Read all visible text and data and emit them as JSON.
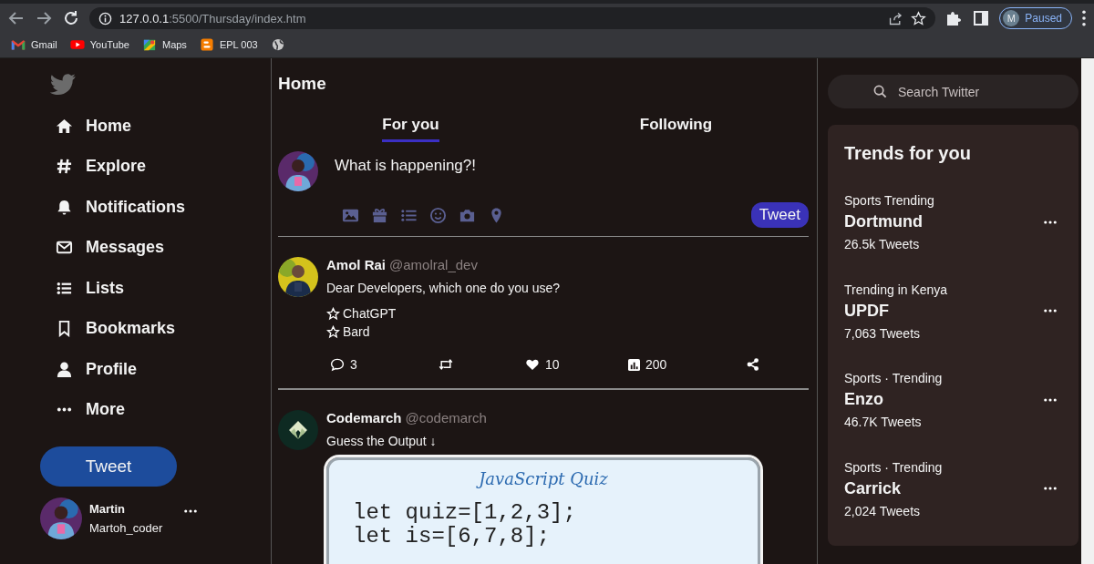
{
  "browser": {
    "address": {
      "host": "127.0.0.1",
      "path": ":5500/Thursday/index.htm"
    },
    "profile": {
      "initial": "M",
      "status": "Paused"
    },
    "bookmarks": [
      "Gmail",
      "YouTube",
      "Maps",
      "EPL 003"
    ]
  },
  "sidebar": {
    "items": [
      "Home",
      "Explore",
      "Notifications",
      "Messages",
      "Lists",
      "Bookmarks",
      "Profile",
      "More"
    ],
    "tweet_button": "Tweet",
    "account": {
      "name": "Martin",
      "handle": "Martoh_coder"
    }
  },
  "feed": {
    "title": "Home",
    "tabs": [
      {
        "label": "For you",
        "selected": true
      },
      {
        "label": "Following",
        "selected": false
      }
    ],
    "composer": {
      "placeholder": "What is happening?!",
      "button": "Tweet"
    },
    "tweets": [
      {
        "name": "Amol Rai",
        "handle": "@amolral_dev",
        "text": "Dear Developers, which one do you use?",
        "options": [
          "ChatGPT",
          "Bard"
        ],
        "replies": "3",
        "likes": "10",
        "views": "200"
      },
      {
        "name": "Codemarch",
        "handle": "@codemarch",
        "text": "Guess the Output ↓",
        "card": {
          "title": "JavaScript Quiz",
          "code": [
            "let quiz=[1,2,3];",
            "let is=[6,7,8];"
          ]
        }
      }
    ]
  },
  "search": {
    "placeholder": "Search Twitter"
  },
  "trends": {
    "title": "Trends for you",
    "items": [
      {
        "category": "Sports Trending",
        "name": "Dortmund",
        "count": "26.5k Tweets"
      },
      {
        "category": "Trending in Kenya",
        "name": "UPDF",
        "count": "7,063 Tweets"
      },
      {
        "category": "Sports · Trending",
        "name": "Enzo",
        "count": "46.7K Tweets"
      },
      {
        "category": "Sports · Trending",
        "name": "Carrick",
        "count": "2,024 Tweets"
      }
    ]
  }
}
